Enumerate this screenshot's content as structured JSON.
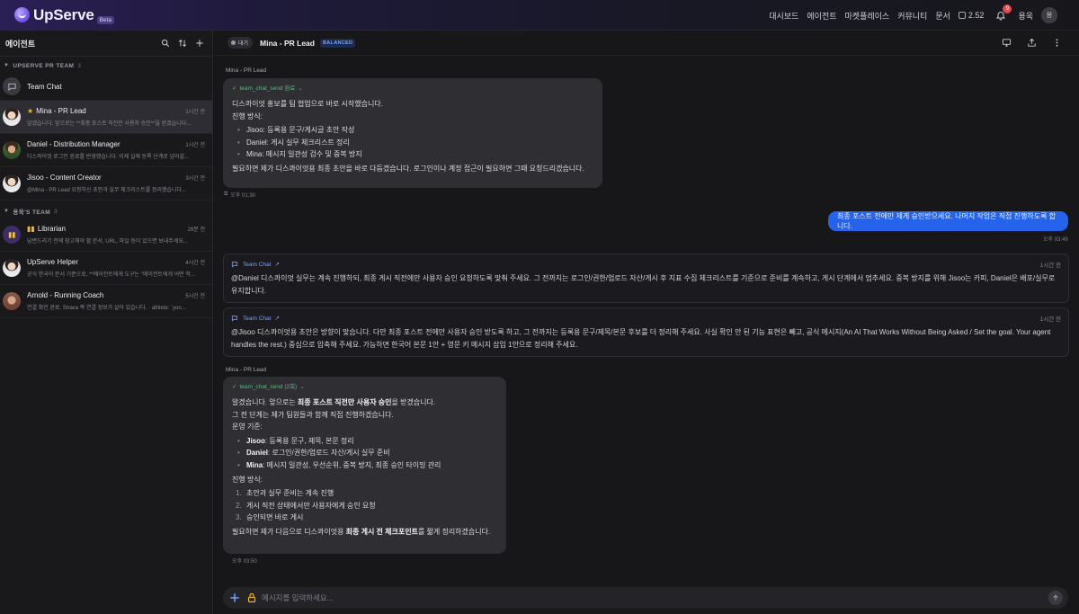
{
  "brand": {
    "name": "UpServe",
    "badge": "Beta"
  },
  "topnav": {
    "items": [
      "대시보드",
      "에이전트",
      "마켓플레이스",
      "커뮤니티",
      "문서"
    ],
    "credits": "2.52",
    "notifications": "9",
    "user_name": "용욱",
    "user_initial": "용"
  },
  "sidebar": {
    "title": "에이전트",
    "teams": [
      {
        "name": "UPSERVE PR TEAM",
        "count": "3"
      },
      {
        "name": "용욱'S TEAM",
        "count": "3"
      }
    ],
    "team_chat": "Team Chat",
    "agents": [
      {
        "name": "Mina - PR Lead",
        "time": "1시간 전",
        "preview": "알겠습니다. 앞으로는 **최종 포스트 직전만 사용자 승인**을 받겠습니다..."
      },
      {
        "name": "Daniel - Distribution Manager",
        "time": "1시간 전",
        "preview": "디스콰이엇 로그인 완료를 반영했습니다. 이제 실제 등록 단계로 넘어갈..."
      },
      {
        "name": "Jisoo - Content Creator",
        "time": "3시간 전",
        "preview": "@Mina - PR Lead 요청하신 초안과 실무 체크리스트를 정리했습니다..."
      },
      {
        "name": "Librarian",
        "time": "28분 전",
        "preview": "답변드리기 전에 참고해야 할 문서, URL, 파일 등이 있으면 보내주세요..."
      },
      {
        "name": "UpServe Helper",
        "time": "4시간 전",
        "preview": "공식 한국어 문서 기준으로, **에이전트에게 도구는 \"에이전트에게 어떤 작..."
      },
      {
        "name": "Arnold - Running Coach",
        "time": "5시간 전",
        "preview": "연결 확인 완료. Strava 쪽 연결 정보가 살아 있습니다. · athlete: `yon..."
      }
    ]
  },
  "chat": {
    "status": "대기",
    "title": "Mina - PR Lead",
    "mode": "BALANCED",
    "messages": {
      "m1": {
        "sender": "Mina - PR Lead",
        "tool": "team_chat_send 완료",
        "intro": "디스콰이엇 홍보를 팀 협업으로 바로 시작했습니다.",
        "method": "진행 방식:",
        "items": [
          "Jisoo: 등록용 문구/게시글 초안 작성",
          "Daniel: 게시 실무 체크리스트 정리",
          "Mina: 메시지 일관성 검수 및 중복 방지"
        ],
        "outro": "필요하면 제가 디스콰이엇용 최종 초안을 바로 다듬겠습니다. 로그인이나 계정 접근이 필요하면 그때 요청드리겠습니다.",
        "time": "오후 01:30"
      },
      "m2": {
        "text": "최종 포스트 전에만 제게 승인받으세요. 나머지 작업은 직접 진행하도록 합니다.",
        "time": "오후 03:49"
      },
      "m3": {
        "label": "Team Chat",
        "time": "1시간 전",
        "text": "@Daniel 디스콰이엇 실무는 계속 진행하되, 최종 게시 직전에만 사용자 승인 요청하도록 맞춰 주세요. 그 전까지는 로그인/권한/업로드 자산/게시 후 지표 수집 체크리스트를 기준으로 준비를 계속하고, 게시 단계에서 멈추세요. 중복 방지를 위해 Jisoo는 카피, Daniel은 배포/실무로 유지합니다."
      },
      "m4": {
        "label": "Team Chat",
        "time": "1시간 전",
        "text": "@Jisoo 디스콰이엇용 초안은 방향이 맞습니다. 다만 최종 포스트 전에만 사용자 승인 받도록 하고, 그 전까지는 등록용 문구/제목/본문 후보를 더 정리해 주세요. 사실 확인 안 된 기능 표현은 빼고, 공식 메시지(An AI That Works Without Being Asked / Set the goal. Your agent handles the rest.) 중심으로 압축해 주세요. 가능하면 한국어 본문 1안 + 영문 키 메시지 삽입 1안으로 정리해 주세요."
      },
      "m5": {
        "sender": "Mina - PR Lead",
        "tool": "team_chat_send (2회)",
        "p1_a": "알겠습니다. 앞으로는 ",
        "p1_b": "최종 포스트 직전만 사용자 승인",
        "p1_c": "을 받겠습니다.",
        "p2": "그 전 단계는 제가 팀원들과 함께 직접 진행하겠습니다.",
        "rules_title": "운영 기준:",
        "rules": [
          {
            "who": "Jisoo",
            "what": ": 등록용 문구, 제목, 본문 정리"
          },
          {
            "who": "Daniel",
            "what": ": 로그인/권한/업로드 자산/게시 실무 준비"
          },
          {
            "who": "Mina",
            "what": ": 메시지 일관성, 우선순위, 중복 방지, 최종 승인 타이밍 관리"
          }
        ],
        "steps_title": "진행 방식:",
        "steps": [
          {
            "n": "1.",
            "t": "초안과 실무 준비는 계속 진행"
          },
          {
            "n": "2.",
            "t": "게시 직전 상태에서만 사용자에게 승인 요청"
          },
          {
            "n": "3.",
            "t": "승인되면 바로 게시"
          }
        ],
        "out_a": "필요하면 제가 다음으로 디스콰이엇용 ",
        "out_b": "최종 게시 전 체크포인트",
        "out_c": "를 짧게 정리하겠습니다.",
        "time": "오후 03:50"
      }
    },
    "composer_placeholder": "메시지를 입력하세요..."
  },
  "colors": {
    "accent": "#2563eb",
    "success": "#4fbf7a",
    "link": "#7aa2ff",
    "badge": "#e5484d"
  }
}
